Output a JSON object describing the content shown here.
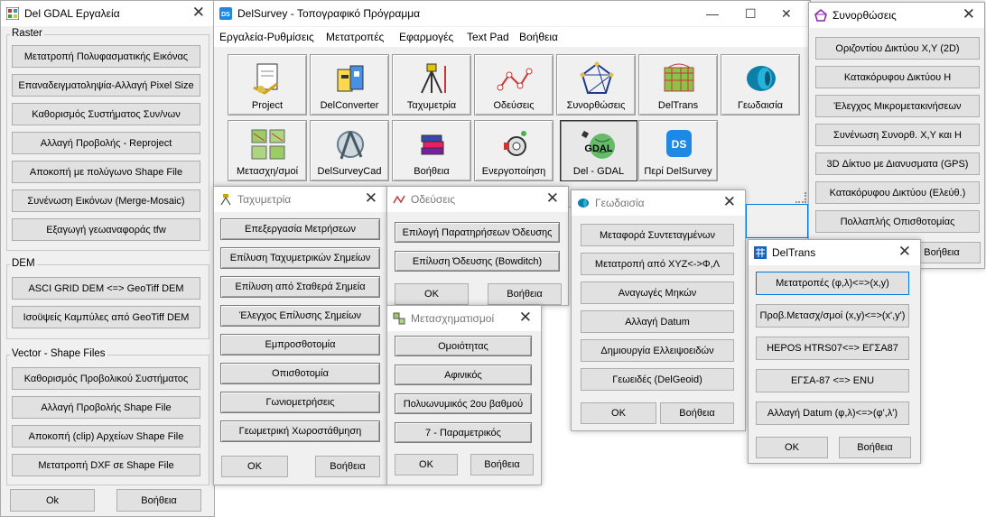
{
  "gdal_tools": {
    "title": "Del GDAL Εργαλεία",
    "raster_label": "Raster",
    "raster_buttons": [
      "Μετατροπή Πολυφασματικής Εικόνας",
      "Επαναδειγματοληψία-Αλλαγή Pixel Size",
      "Καθορισμός Συστήματος Συν/νων",
      "Αλλαγή Προβολής - Reproject",
      "Αποκοπή με πολύγωνο Shape File",
      "Συνένωση Εικόνων (Merge-Mosaic)",
      "Εξαγωγή γεωαναφοράς tfw"
    ],
    "dem_label": "DEM",
    "dem_buttons": [
      "ASCI GRID DEM <=> GeoTiff DEM",
      "Ισοϋψείς Καμπύλες από GeoTiff DEM"
    ],
    "vector_label": "Vector - Shape Files",
    "vector_buttons": [
      "Καθορισμός Προβολικού Συστήματος",
      "Αλλαγή Προβολής Shape File",
      "Αποκοπή (clip) Αρχείων Shape File",
      "Μετατροπή DXF σε Shape File"
    ],
    "ok": "Ok",
    "help": "Βοήθεια"
  },
  "main": {
    "title": "DelSurvey - Τοπογραφικό Πρόγραμμα",
    "menu": [
      "Εργαλεία-Ρυθμίσεις",
      "Μετατροπές",
      "Εφαρμογές",
      "Text Pad",
      "Βοήθεια"
    ],
    "tiles_row1": [
      "Project",
      "DelConverter",
      "Ταχυμετρία",
      "Οδεύσεις",
      "Συνορθώσεις",
      "DelTrans",
      "Γεωδαισία"
    ],
    "tiles_row2": [
      "Μετασχη/σμοί",
      "DelSurveyCad",
      "Βοήθεια",
      "Ενεργοποίηση",
      "Del - GDAL",
      "Περί DelSurvey"
    ],
    "gdal_tile_text": "GDAL",
    "ds_logo": "DS"
  },
  "synorthoseis": {
    "title": "Συνορθώσεις",
    "buttons": [
      "Οριζοντίου Δικτύου Χ,Υ (2D)",
      "Κατακόρυφου Δικτύου Η",
      "Έλεγχος Μικρομετακινήσεων",
      "Συνένωση Συνορθ. Χ,Υ και Η",
      "3D Δίκτυο με Διανυσματα (GPS)",
      "Κατακόρυφου Δικτύου (Ελεύθ.)",
      "Πολλαπλής Οπισθοτομίας"
    ],
    "help": "Βοήθεια"
  },
  "tachymetria": {
    "title": "Ταχυμετρία",
    "buttons": [
      "Επεξεργασία Μετρήσεων",
      "Επίλυση Ταχυμετρικών Σημείων",
      "Επίλυση από Σταθερά Σημεία",
      "Έλεγχος Επίλυσης Σημείων",
      "Εμπροσθοτομία",
      "Οπισθοτομία",
      "Γωνιομετρήσεις",
      "Γεωμετρική Χωροστάθμηση"
    ],
    "ok": "OK",
    "help": "Βοήθεια"
  },
  "odeuseis": {
    "title": "Οδεύσεις",
    "buttons": [
      "Επιλογή Παρατηρήσεων Όδευσης",
      "Επίλυση Όδευσης (Bowditch)"
    ],
    "ok": "OK",
    "help": "Βοήθεια"
  },
  "metasx": {
    "title": "Μετασχηματισμοί",
    "buttons": [
      "Ομοιότητας",
      "Αφινικός",
      "Πολυωνυμικός 2ου βαθμού",
      "7 - Παραμετρικός"
    ],
    "ok": "OK",
    "help": "Βοήθεια"
  },
  "geodaisia": {
    "title": "Γεωδαισία",
    "buttons": [
      "Μεταφορά Συντεταγμένων",
      "Μετατροπή από XYZ<->Φ,Λ",
      "Αναγωγές Μηκών",
      "Αλλαγή Datum",
      "Δημιουργία Ελλειψοειδών",
      "Γεωειδές (DelGeoid)"
    ],
    "ok": "OK",
    "help": "Βοήθεια"
  },
  "deltrans": {
    "title": "DelTrans",
    "buttons": [
      "Μετατροπές (φ,λ)<=>(x,y)",
      "Προβ.Μετασχ/σμοί (x,y)<=>(x',y')",
      "HEPOS HTRS07<=> ΕΓΣΑ87",
      "ΕΓΣΑ-87 <=> ENU",
      "Αλλαγή Datum (φ,λ)<=>(φ',λ')"
    ],
    "ok": "OK",
    "help": "Βοήθεια"
  }
}
